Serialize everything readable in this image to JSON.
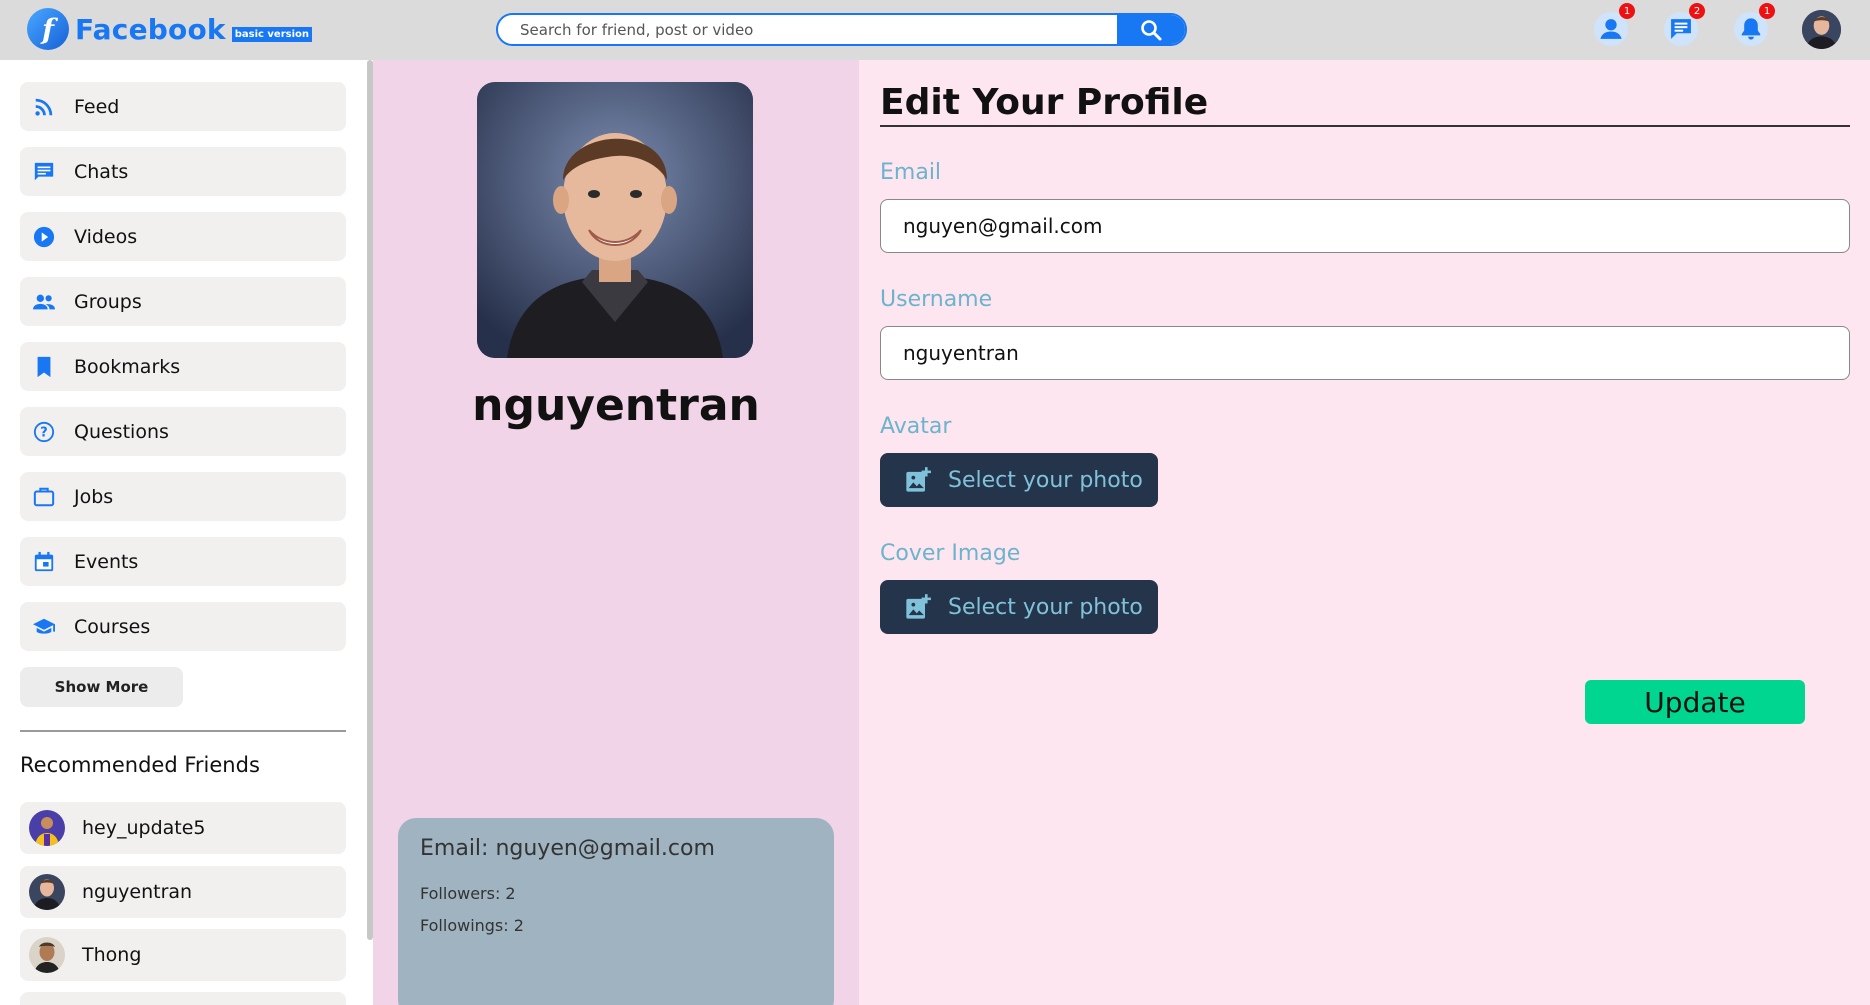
{
  "brand": {
    "name": "Facebook",
    "logo_letter": "f",
    "badge": "basic version",
    "color": "#1877f2"
  },
  "search": {
    "placeholder": "Search for friend, post or video",
    "value": "",
    "icon": "search-icon"
  },
  "top_actions": [
    {
      "name": "friend-requests",
      "icon": "person-icon",
      "badge": "1"
    },
    {
      "name": "messages",
      "icon": "chat-icon",
      "badge": "2"
    },
    {
      "name": "notifications",
      "icon": "bell-icon",
      "badge": "1"
    }
  ],
  "sidebar": {
    "items": [
      {
        "label": "Feed",
        "icon": "rss-icon"
      },
      {
        "label": "Chats",
        "icon": "chat-icon"
      },
      {
        "label": "Videos",
        "icon": "play-icon"
      },
      {
        "label": "Groups",
        "icon": "group-icon"
      },
      {
        "label": "Bookmarks",
        "icon": "bookmark-icon"
      },
      {
        "label": "Questions",
        "icon": "question-icon"
      },
      {
        "label": "Jobs",
        "icon": "briefcase-icon"
      },
      {
        "label": "Events",
        "icon": "calendar-icon"
      },
      {
        "label": "Courses",
        "icon": "school-icon"
      }
    ],
    "show_more": "Show More",
    "recommended_title": "Recommended Friends",
    "friends": [
      {
        "name": "hey_update5"
      },
      {
        "name": "nguyentran"
      },
      {
        "name": "Thong"
      }
    ],
    "icon_color": "#1877f2"
  },
  "profile": {
    "username": "nguyentran",
    "info": {
      "email_line": "Email: nguyen@gmail.com",
      "followers_line": "Followers: 2",
      "followings_line": "Followings: 2"
    }
  },
  "form": {
    "title": "Edit Your Profile",
    "email_label": "Email",
    "email_value": "nguyen@gmail.com",
    "username_label": "Username",
    "username_value": "nguyentran",
    "avatar_label": "Avatar",
    "avatar_button": "Select your photo",
    "cover_label": "Cover Image",
    "cover_button": "Select your photo",
    "update_button": "Update",
    "colors": {
      "label": "#6bb4cc",
      "photo_button_bg": "#24344a",
      "update_bg": "#00d68f"
    }
  }
}
